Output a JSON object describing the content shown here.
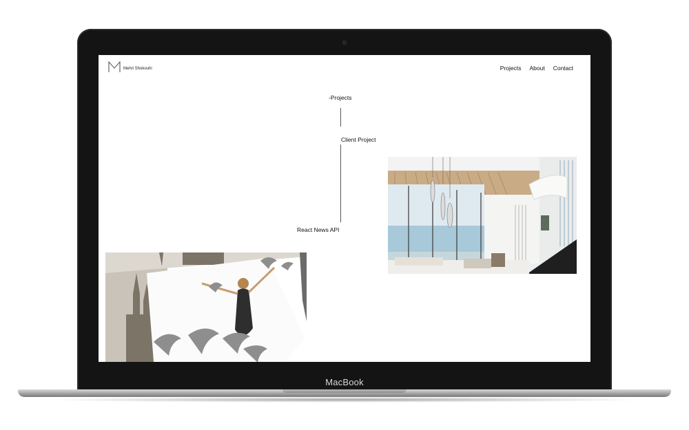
{
  "device": {
    "brand": "MacBook"
  },
  "site": {
    "logo_letter": "M",
    "owner_name": "Mehri Shokouhi",
    "nav": [
      {
        "label": "Projects"
      },
      {
        "label": "About"
      },
      {
        "label": "Contact"
      }
    ],
    "section_heading": "-Projects",
    "projects": [
      {
        "label": "Client Project"
      },
      {
        "label": "React News API"
      }
    ]
  },
  "colors": {
    "page_bg": "#ffffff",
    "text": "#111111",
    "bezel": "#141414"
  }
}
